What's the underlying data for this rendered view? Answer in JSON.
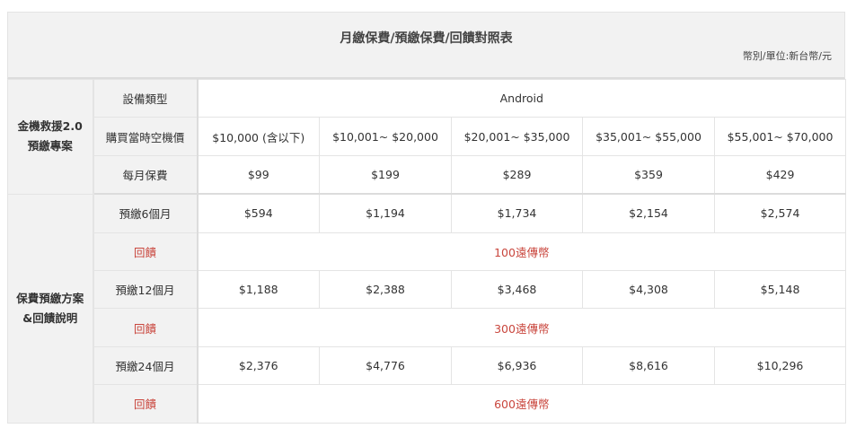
{
  "header": {
    "title": "月繳保費/預繳保費/回饋對照表",
    "unit": "幣別/單位:新台幣/元"
  },
  "sections": {
    "plan": [
      "金機救援2.0",
      "預繳專案"
    ],
    "prepay": [
      "保費預繳方案",
      "&回饋說明"
    ]
  },
  "rows": {
    "device_type": {
      "label": "設備類型",
      "value": "Android"
    },
    "price": {
      "label": "購買當時空機價",
      "values": [
        "$10,000 (含以下)",
        "$10,001~ $20,000",
        "$20,001~ $35,000",
        "$35,001~ $55,000",
        "$55,001~ $70,000"
      ]
    },
    "monthly": {
      "label": "每月保費",
      "values": [
        "$99",
        "$199",
        "$289",
        "$359",
        "$429"
      ]
    },
    "pre6": {
      "label": "預繳6個月",
      "values": [
        "$594",
        "$1,194",
        "$1,734",
        "$2,154",
        "$2,574"
      ]
    },
    "reward6": {
      "label": "回饋",
      "value": "100遠傳幣"
    },
    "pre12": {
      "label": "預繳12個月",
      "values": [
        "$1,188",
        "$2,388",
        "$3,468",
        "$4,308",
        "$5,148"
      ]
    },
    "reward12": {
      "label": "回饋",
      "value": "300遠傳幣"
    },
    "pre24": {
      "label": "預繳24個月",
      "values": [
        "$2,376",
        "$4,776",
        "$6,936",
        "$8,616",
        "$10,296"
      ]
    },
    "reward24": {
      "label": "回饋",
      "value": "600遠傳幣"
    }
  },
  "colors": {
    "reward_text": "#c9463d",
    "label_bg": "#f2f2f2"
  }
}
